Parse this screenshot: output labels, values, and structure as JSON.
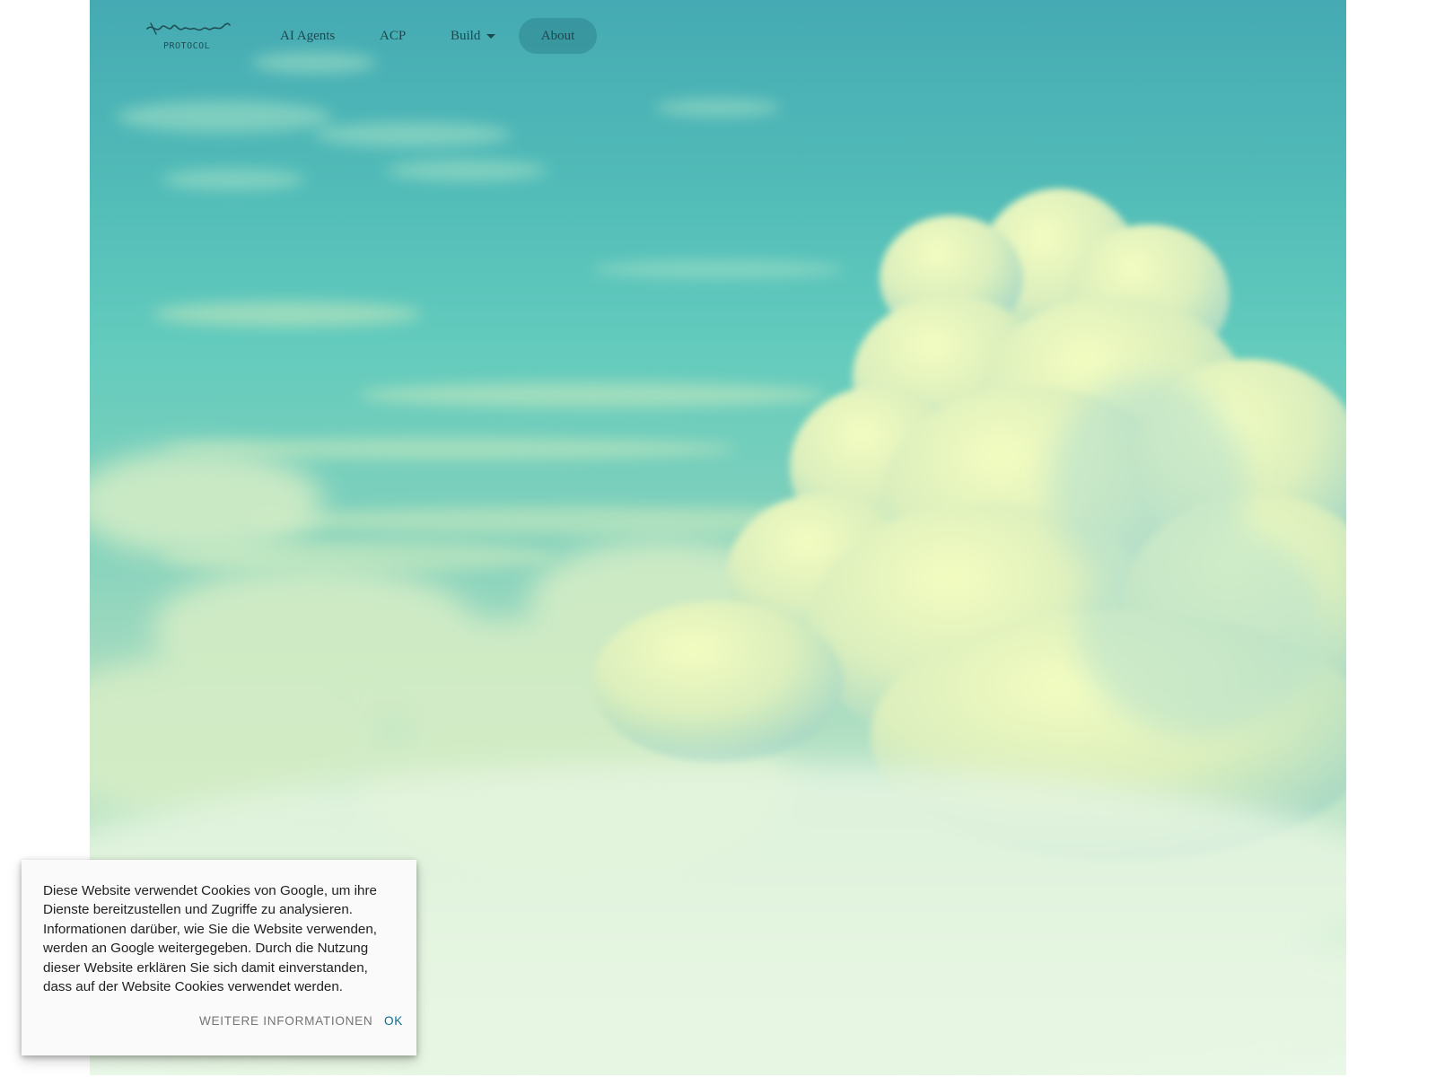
{
  "logo": {
    "script_text": "Virtuals",
    "sub_text": "PROTOCOL"
  },
  "nav": {
    "items": [
      {
        "label": "AI Agents"
      },
      {
        "label": "ACP"
      },
      {
        "label": "Build",
        "icon": "caret-down-icon"
      },
      {
        "label": "About",
        "active": true
      }
    ]
  },
  "cookie_banner": {
    "text": "Diese Website verwendet Cookies von Google, um ihre Dienste bereitzustellen und Zugriffe zu analysieren. Informationen darüber, wie Sie die Website verwenden, werden an Google weitergegeben. Durch die Nutzung dieser Website erklären Sie sich damit einverstanden, dass auf der Website Cookies verwendet werden.",
    "more_label": "WEITERE INFORMATIONEN",
    "ok_label": "OK"
  },
  "colors": {
    "sky_top": "#45aab3",
    "sky_bottom": "#eaf8ea",
    "cloud_highlight": "#eefcb8",
    "nav_text": "#1e4850",
    "active_pill": "#3f8f97",
    "ok_button": "#0b6d8f",
    "more_button": "#757575"
  }
}
